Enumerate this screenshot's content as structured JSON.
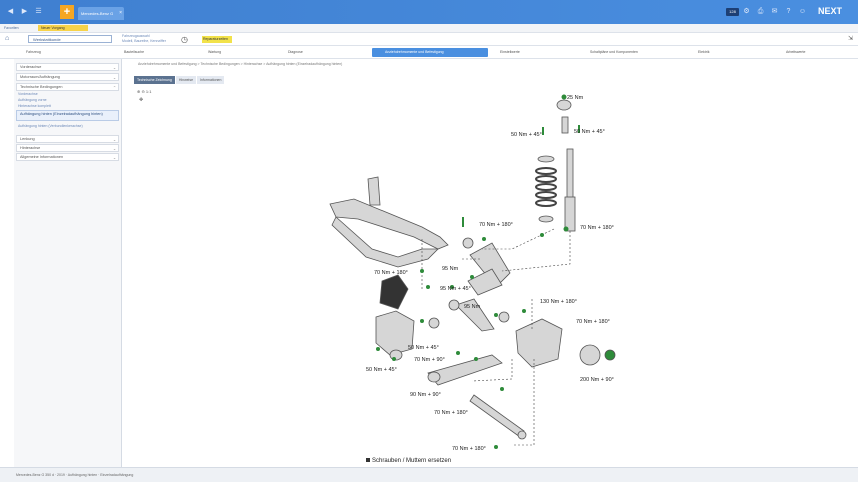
{
  "topbar": {
    "tab_label": "Mercedes-Benz G",
    "count": "128",
    "brand": "NEXT"
  },
  "row1": {
    "tab": "Favoriten",
    "badge_text": "Neuer Vorgang"
  },
  "row2": {
    "select_value": "Werkstattkunde",
    "vehicle_line1": "Fahrzeugauswahl",
    "vehicle_line2": "Modell, Baureihe, Kennziffer",
    "badge": "Reparaturzeiten"
  },
  "nav": {
    "items": [
      "Fahrzeug",
      "Bauteilsuche",
      "Wartung",
      "Diagnose",
      "Anziehdrehmomente und Befestigung",
      "Einstellwerte",
      "Schaltpläne und Komponenten",
      "Elektrik",
      "Arbeitswerte"
    ],
    "active_index": 4
  },
  "sidebar": {
    "items": [
      "Vorderachse",
      "Motorraum/Aufhängung",
      "Technische Bedingungen",
      "Lenkung",
      "Hinterachse",
      "Allgemeine Informationen"
    ],
    "subs": [
      "Vorderachse",
      "Aufhängung vorne",
      "Hinterachse komplett",
      "Aufhängung hinten (Einzelradaufhängung hinten)",
      "Aufhängung hinten (Verbundlenkerachse)"
    ]
  },
  "content": {
    "breadcrumb": "Anziehdrehmomente und Befestigung  >  Technische Bedingungen  >  Hinterachse  >  Aufhängung hinten (Einzelradaufhängung hinten)",
    "tabs": [
      "Technische Zeichnung",
      "Hinweise",
      "Informationen"
    ],
    "zoom": "⊕ ⊖ 1:1",
    "legend_text": "Schrauben / Muttern ersetzen"
  },
  "torques": [
    "25 Nm",
    "50 Nm + 45°",
    "50 Nm + 45°",
    "70 Nm + 180°",
    "70 Nm + 180°",
    "70 Nm + 180°",
    "95 Nm",
    "95 Nm + 45°",
    "95 Nm",
    "130 Nm + 180°",
    "70 Nm + 180°",
    "50 Nm + 45°",
    "70 Nm + 90°",
    "50 Nm + 45°",
    "200 Nm + 90°",
    "90 Nm + 90°",
    "70 Nm + 180°",
    "70 Nm + 180°"
  ],
  "status": {
    "text": "Mercedes-Benz G 350 d · 2019 · Aufhängung hinten · Einzelradaufhängung"
  },
  "colors": {
    "accent": "#4a8fe0",
    "marker": "#2e8b3a",
    "badge": "#f7d34a"
  }
}
